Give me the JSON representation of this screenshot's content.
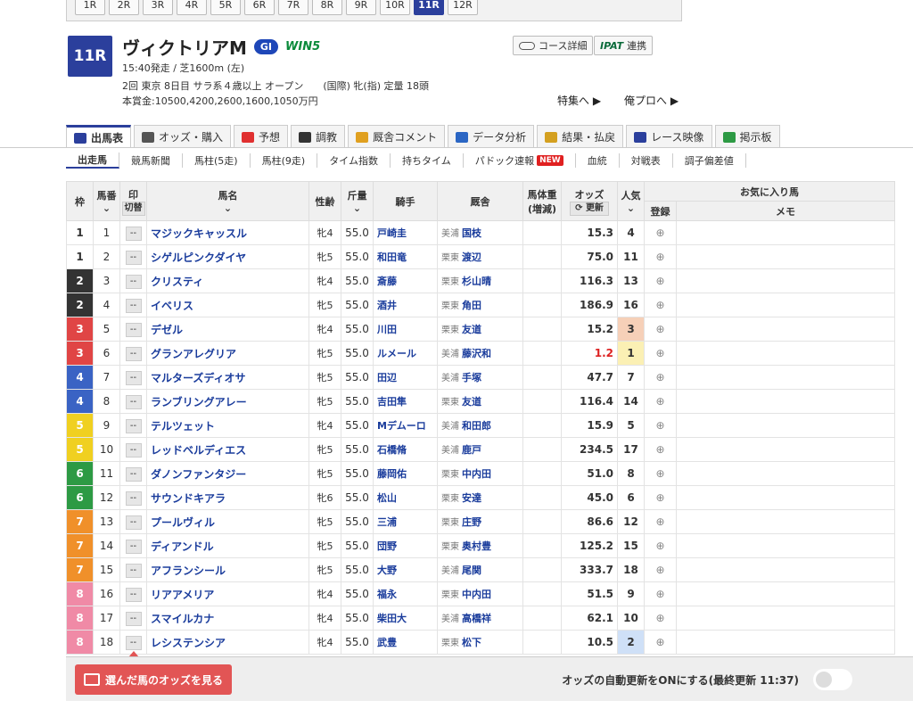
{
  "race_nav": [
    "1R",
    "2R",
    "3R",
    "4R",
    "5R",
    "6R",
    "7R",
    "8R",
    "9R",
    "10R",
    "11R",
    "12R"
  ],
  "race_nav_active": "11R",
  "race": {
    "number": "11R",
    "name": "ヴィクトリアM",
    "grade": "GI",
    "win5": "WIN5",
    "line1": "15:40発走 / 芝1600m (左)",
    "line2": "2回 東京 8日目 サラ系４歳以上 オープン　　(国際) 牝(指) 定量 18頭",
    "line3": "本賞金:10500,4200,2600,1600,1050万円"
  },
  "header_buttons": {
    "course": "コース詳細",
    "ipat": "IPAT",
    "ipat_suffix": "連携"
  },
  "header_links": {
    "special": "特集へ ▶",
    "pro": "俺プロへ ▶"
  },
  "tabs": [
    "出馬表",
    "オッズ・購入",
    "予想",
    "調教",
    "厩舎コメント",
    "データ分析",
    "結果・払戻",
    "レース映像",
    "掲示板"
  ],
  "subnav": [
    "出走馬",
    "競馬新聞",
    "馬柱(5走)",
    "馬柱(9走)",
    "タイム指数",
    "持ちタイム",
    "パドック速報",
    "血統",
    "対戦表",
    "調子偏差値"
  ],
  "new_badge": "NEW",
  "columns": {
    "waku": "枠",
    "umaban": "馬番",
    "mark": "印",
    "mark_toggle": "切替",
    "name": "馬名",
    "sexage": "性齢",
    "kinryo": "斤量",
    "jockey": "騎手",
    "stable": "厩舎",
    "weight": "馬体重",
    "weight_sub": "(増減)",
    "odds": "オッズ",
    "odds_update": "更新",
    "popularity": "人気",
    "register": "登録",
    "favorites": "お気に入り馬",
    "memo": "メモ"
  },
  "mark_placeholder": "--",
  "horses": [
    {
      "waku": "1",
      "uma": "1",
      "name": "マジックキャッスル",
      "sexage": "牝4",
      "kinryo": "55.0",
      "jockey": "戸崎圭",
      "loc": "美浦",
      "trainer": "国枝",
      "odds": "15.3",
      "pop": "4"
    },
    {
      "waku": "1",
      "uma": "2",
      "name": "シゲルピンクダイヤ",
      "sexage": "牝5",
      "kinryo": "55.0",
      "jockey": "和田竜",
      "loc": "栗東",
      "trainer": "渡辺",
      "odds": "75.0",
      "pop": "11"
    },
    {
      "waku": "2",
      "uma": "3",
      "name": "クリスティ",
      "sexage": "牝4",
      "kinryo": "55.0",
      "jockey": "斎藤",
      "loc": "栗東",
      "trainer": "杉山晴",
      "odds": "116.3",
      "pop": "13"
    },
    {
      "waku": "2",
      "uma": "4",
      "name": "イベリス",
      "sexage": "牝5",
      "kinryo": "55.0",
      "jockey": "酒井",
      "loc": "栗東",
      "trainer": "角田",
      "odds": "186.9",
      "pop": "16"
    },
    {
      "waku": "3",
      "uma": "5",
      "name": "デゼル",
      "sexage": "牝4",
      "kinryo": "55.0",
      "jockey": "川田",
      "loc": "栗東",
      "trainer": "友道",
      "odds": "15.2",
      "pop": "3"
    },
    {
      "waku": "3",
      "uma": "6",
      "name": "グランアレグリア",
      "sexage": "牝5",
      "kinryo": "55.0",
      "jockey": "ルメール",
      "loc": "美浦",
      "trainer": "藤沢和",
      "odds": "1.2",
      "pop": "1"
    },
    {
      "waku": "4",
      "uma": "7",
      "name": "マルターズディオサ",
      "sexage": "牝5",
      "kinryo": "55.0",
      "jockey": "田辺",
      "loc": "美浦",
      "trainer": "手塚",
      "odds": "47.7",
      "pop": "7"
    },
    {
      "waku": "4",
      "uma": "8",
      "name": "ランブリングアレー",
      "sexage": "牝5",
      "kinryo": "55.0",
      "jockey": "吉田隼",
      "loc": "栗東",
      "trainer": "友道",
      "odds": "116.4",
      "pop": "14"
    },
    {
      "waku": "5",
      "uma": "9",
      "name": "テルツェット",
      "sexage": "牝4",
      "kinryo": "55.0",
      "jockey": "Mデムーロ",
      "loc": "美浦",
      "trainer": "和田郎",
      "odds": "15.9",
      "pop": "5"
    },
    {
      "waku": "5",
      "uma": "10",
      "name": "レッドベルディエス",
      "sexage": "牝5",
      "kinryo": "55.0",
      "jockey": "石橋脩",
      "loc": "美浦",
      "trainer": "鹿戸",
      "odds": "234.5",
      "pop": "17"
    },
    {
      "waku": "6",
      "uma": "11",
      "name": "ダノンファンタジー",
      "sexage": "牝5",
      "kinryo": "55.0",
      "jockey": "藤岡佑",
      "loc": "栗東",
      "trainer": "中内田",
      "odds": "51.0",
      "pop": "8"
    },
    {
      "waku": "6",
      "uma": "12",
      "name": "サウンドキアラ",
      "sexage": "牝6",
      "kinryo": "55.0",
      "jockey": "松山",
      "loc": "栗東",
      "trainer": "安達",
      "odds": "45.0",
      "pop": "6"
    },
    {
      "waku": "7",
      "uma": "13",
      "name": "プールヴィル",
      "sexage": "牝5",
      "kinryo": "55.0",
      "jockey": "三浦",
      "loc": "栗東",
      "trainer": "庄野",
      "odds": "86.6",
      "pop": "12"
    },
    {
      "waku": "7",
      "uma": "14",
      "name": "ディアンドル",
      "sexage": "牝5",
      "kinryo": "55.0",
      "jockey": "団野",
      "loc": "栗東",
      "trainer": "奥村豊",
      "odds": "125.2",
      "pop": "15"
    },
    {
      "waku": "7",
      "uma": "15",
      "name": "アフランシール",
      "sexage": "牝5",
      "kinryo": "55.0",
      "jockey": "大野",
      "loc": "美浦",
      "trainer": "尾関",
      "odds": "333.7",
      "pop": "18"
    },
    {
      "waku": "8",
      "uma": "16",
      "name": "リアアメリア",
      "sexage": "牝4",
      "kinryo": "55.0",
      "jockey": "福永",
      "loc": "栗東",
      "trainer": "中内田",
      "odds": "51.5",
      "pop": "9"
    },
    {
      "waku": "8",
      "uma": "17",
      "name": "スマイルカナ",
      "sexage": "牝4",
      "kinryo": "55.0",
      "jockey": "柴田大",
      "loc": "美浦",
      "trainer": "高橋祥",
      "odds": "62.1",
      "pop": "10"
    },
    {
      "waku": "8",
      "uma": "18",
      "name": "レシステンシア",
      "sexage": "牝4",
      "kinryo": "55.0",
      "jockey": "武豊",
      "loc": "栗東",
      "trainer": "松下",
      "odds": "10.5",
      "pop": "2"
    }
  ],
  "waku_colors": {
    "1": {
      "bg": "#ffffff",
      "fg": "#333333"
    },
    "2": {
      "bg": "#333333",
      "fg": "#ffffff"
    },
    "3": {
      "bg": "#e04545",
      "fg": "#ffffff"
    },
    "4": {
      "bg": "#3a63c4",
      "fg": "#ffffff"
    },
    "5": {
      "bg": "#f0d020",
      "fg": "#ffffff"
    },
    "6": {
      "bg": "#2d9a44",
      "fg": "#ffffff"
    },
    "7": {
      "bg": "#f0902a",
      "fg": "#ffffff"
    },
    "8": {
      "bg": "#f08aa6",
      "fg": "#ffffff"
    }
  },
  "footer": {
    "show_odds": "選んだ馬のオッズを見る",
    "auto_update": "オッズの自動更新をONにする(最終更新 11:37)"
  }
}
